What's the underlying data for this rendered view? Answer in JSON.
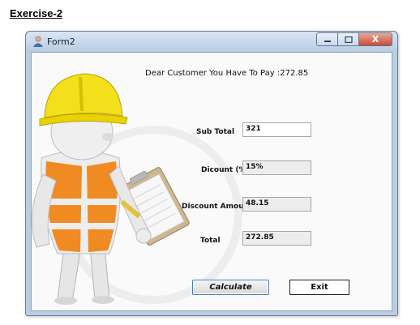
{
  "document": {
    "heading": "Exercise-2"
  },
  "window": {
    "title": "Form2",
    "icons": {
      "app": "user-icon",
      "minimize": "minimize-icon",
      "maximize": "maximize-icon",
      "close": "close-icon"
    },
    "close_glyph": "X"
  },
  "form": {
    "message": "Dear Customer You Have To Pay :272.85",
    "sub_total": {
      "label": "Sub Total",
      "value": "321"
    },
    "discount": {
      "label": "Dicount (%)",
      "value": "15%"
    },
    "discount_amount": {
      "label": "Discount Amount",
      "value": "48.15"
    },
    "total": {
      "label": "Total",
      "value": "272.85"
    },
    "calculate_label": "Calculate",
    "exit_label": "Exit"
  },
  "colors": {
    "titlebar": "#b9cde3",
    "close_button": "#c74b34",
    "focus_border": "#3a7bd5",
    "helmet": "#f3e01a",
    "vest": "#f08a22"
  }
}
